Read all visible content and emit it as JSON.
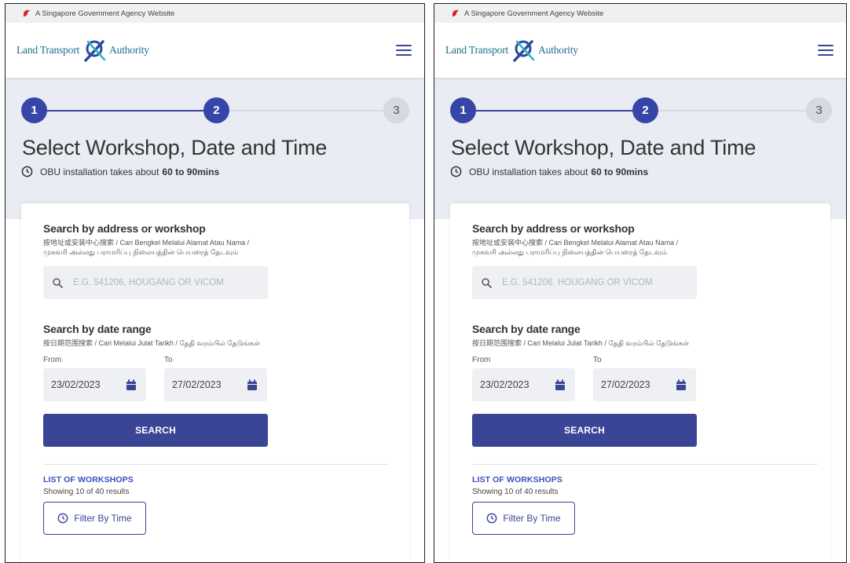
{
  "gov_banner": {
    "text": "A Singapore Government Agency Website"
  },
  "header": {
    "logo_left": "Land Transport",
    "logo_right": "Authority",
    "menu_icon": "hamburger-menu-icon"
  },
  "stepper": {
    "steps": [
      "1",
      "2",
      "3"
    ],
    "current_step": 2
  },
  "page": {
    "title": "Select Workshop, Date and Time",
    "duration_prefix": "OBU installation takes about",
    "duration_value": "60 to 90mins"
  },
  "search_address": {
    "title": "Search by address or workshop",
    "subtitle": "按地址或安装中心搜索 / Cari Bengkel Melalui Alamat Atau Nama / முகவரி அல்லது பராமரிப்பு நிலையத்தின் பெயரைத் தேடவும்",
    "placeholder": "E.G. 541206, HOUGANG OR VICOM"
  },
  "search_date": {
    "title": "Search by date range",
    "subtitle": "按日期范围搜索 / Cari Melalui Julat Tarikh / தேதி வரம்பில் தேடுங்கள்",
    "from_label": "From",
    "to_label": "To",
    "from_value": "23/02/2023",
    "to_value": "27/02/2023"
  },
  "search_button": {
    "label": "SEARCH"
  },
  "workshops": {
    "title": "LIST OF WORKSHOPS",
    "count_text": "Showing 10 of 40 results",
    "filter_label": "Filter By Time"
  },
  "colors": {
    "primary": "#3b4595",
    "step_active": "#3845a8",
    "link": "#3b4fc0",
    "hero_bg": "#e9ecf3"
  }
}
